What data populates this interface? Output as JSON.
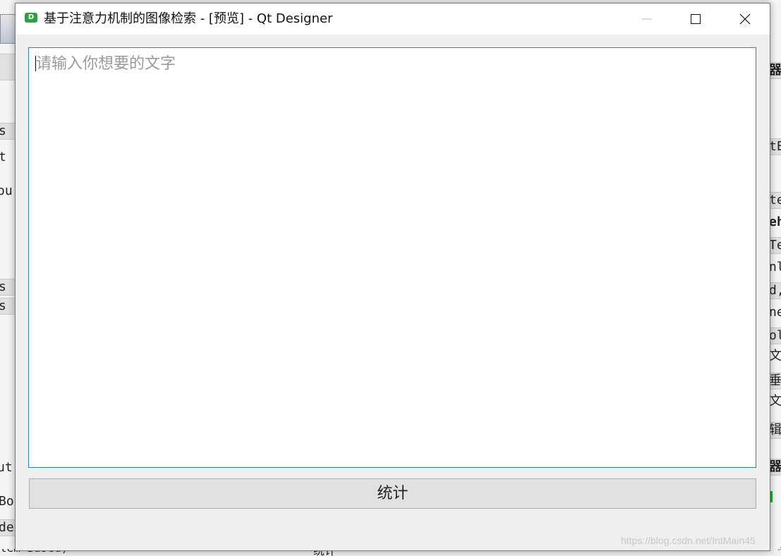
{
  "background_app": {
    "left_fragments": [
      "s",
      "t",
      "ou",
      "s",
      "s",
      "ut",
      "Bo",
      "de"
    ],
    "right_fragments": [
      "器",
      "tE",
      "te",
      "eh",
      "Te",
      "nl",
      "d,",
      "ne",
      "ol",
      "文乎",
      "垂直",
      "文乎",
      "辑",
      "器"
    ],
    "bottom_fragments": [
      "tem Based)",
      "统计"
    ]
  },
  "window": {
    "title": "基于注意力机制的图像检索 - [预览] - Qt Designer",
    "app_icon_letter": "D"
  },
  "text_input": {
    "placeholder": "请输入你想要的文字",
    "value": ""
  },
  "button": {
    "label": "统计"
  },
  "watermark": "https://blog.csdn.net/IntMain45",
  "colors": {
    "focus_border": "#2f7fc1",
    "app_icon": "#2ea043",
    "button_bg": "#e1e1e1"
  }
}
